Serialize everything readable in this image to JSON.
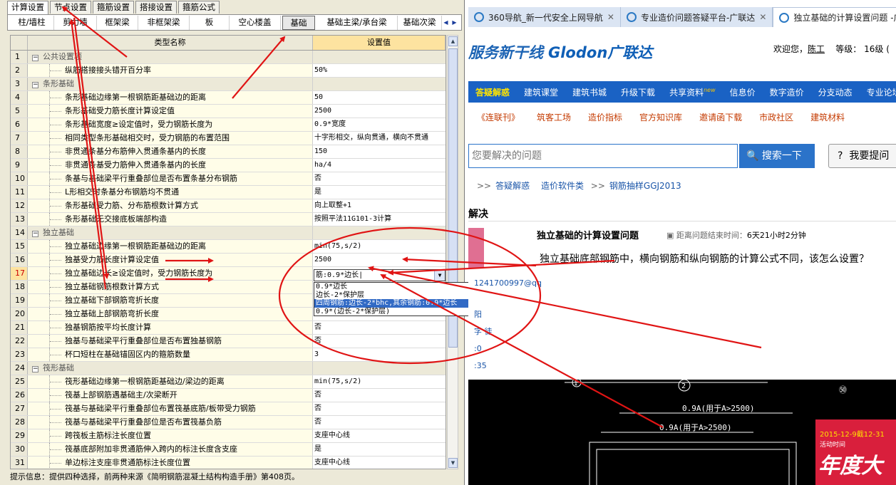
{
  "left_app": {
    "top_tabs": [
      "计算设置",
      "节点设置",
      "箍筋设置",
      "搭接设置",
      "箍筋公式"
    ],
    "sub_tabs": [
      "柱/墙柱",
      "剪力墙",
      "框架梁",
      "非框架梁",
      "板",
      "空心楼盖",
      "基础",
      "基础主梁/承台梁",
      "基础次梁"
    ],
    "grid_header": {
      "name": "类型名称",
      "value": "设置值"
    },
    "rows": [
      {
        "n": "1",
        "name": "公共设置项",
        "value": "",
        "type": "group"
      },
      {
        "n": "2",
        "name": "纵筋搭接接头错开百分率",
        "value": "50%",
        "type": "data"
      },
      {
        "n": "3",
        "name": "条形基础",
        "value": "",
        "type": "group"
      },
      {
        "n": "4",
        "name": "条形基础边缘第一根钢筋距基础边的距离",
        "value": "50",
        "type": "data"
      },
      {
        "n": "5",
        "name": "条形基础受力筋长度计算设定值",
        "value": "2500",
        "type": "data"
      },
      {
        "n": "6",
        "name": "条形基础宽度≥设定值时，受力钢筋长度为",
        "value": "0.9*宽度",
        "type": "data"
      },
      {
        "n": "7",
        "name": "相同类型条形基础相交时，受力钢筋的布置范围",
        "value": "十字形相交，纵向贯通，横向不贯通",
        "type": "data"
      },
      {
        "n": "8",
        "name": "非贯通条基分布筋伸入贯通条基内的长度",
        "value": "150",
        "type": "data"
      },
      {
        "n": "9",
        "name": "非贯通条基受力筋伸入贯通条基内的长度",
        "value": "ha/4",
        "type": "data"
      },
      {
        "n": "10",
        "name": "条基与基础梁平行重叠部位是否布置条基分布钢筋",
        "value": "否",
        "type": "data"
      },
      {
        "n": "11",
        "name": "L形相交时条基分布钢筋均不贯通",
        "value": "是",
        "type": "data"
      },
      {
        "n": "12",
        "name": "条形基础受力筋、分布筋根数计算方式",
        "value": "向上取整+1",
        "type": "data"
      },
      {
        "n": "13",
        "name": "条形基础无交接底板端部构造",
        "value": "按照平法11G101-3计算",
        "type": "data"
      },
      {
        "n": "14",
        "name": "独立基础",
        "value": "",
        "type": "group"
      },
      {
        "n": "15",
        "name": "独立基础边缘第一根钢筋距基础边的距离",
        "value": "min(75,s/2)",
        "type": "data"
      },
      {
        "n": "16",
        "name": "独基受力筋长度计算设定值",
        "value": "2500",
        "type": "data"
      },
      {
        "n": "17",
        "name": "独立基础边长≥设定值时，受力钢筋长度为",
        "value": "",
        "type": "data",
        "selected": true
      },
      {
        "n": "18",
        "name": "独立基础钢筋根数计算方式",
        "value": "",
        "type": "data"
      },
      {
        "n": "19",
        "name": "独立基础下部钢筋弯折长度",
        "value": "",
        "type": "data"
      },
      {
        "n": "20",
        "name": "独立基础上部钢筋弯折长度",
        "value": "",
        "type": "data"
      },
      {
        "n": "21",
        "name": "独基钢筋按平均长度计算",
        "value": "否",
        "type": "data"
      },
      {
        "n": "22",
        "name": "独基与基础梁平行重叠部位是否布置独基钢筋",
        "value": "否",
        "type": "data"
      },
      {
        "n": "23",
        "name": "杯口短柱在基础锚固区内的箍筋数量",
        "value": "3",
        "type": "data"
      },
      {
        "n": "24",
        "name": "筏形基础",
        "value": "",
        "type": "group"
      },
      {
        "n": "25",
        "name": "筏形基础边缘第一根钢筋距基础边/梁边的距离",
        "value": "min(75,s/2)",
        "type": "data"
      },
      {
        "n": "26",
        "name": "筏基上部钢筋遇基础主/次梁断开",
        "value": "否",
        "type": "data"
      },
      {
        "n": "27",
        "name": "筏基与基础梁平行重叠部位布置筏基底筋/板带受力钢筋",
        "value": "否",
        "type": "data"
      },
      {
        "n": "28",
        "name": "筏基与基础梁平行重叠部位是否布置筏基负筋",
        "value": "否",
        "type": "data"
      },
      {
        "n": "29",
        "name": "跨筏板主筋标注长度位置",
        "value": "支座中心线",
        "type": "data"
      },
      {
        "n": "30",
        "name": "筏基底部附加非贯通筋伸入跨内的标注长度含支座",
        "value": "是",
        "type": "data"
      },
      {
        "n": "31",
        "name": "单边标注支座非贯通筋标注长度位置",
        "value": "支座中心线",
        "type": "data"
      }
    ],
    "edit_cell_value": "筋:0.9*边长|",
    "dropdown_options": [
      "0.9*边长",
      "边长-2*保护层",
      "四周钢筋:边长-2*bhc,其余钢筋:0.9*边长",
      "0.9*(边长-2*保护层)"
    ],
    "dropdown_selected_index": 2,
    "status_text": "提示信息：提供四种选择，前两种来源《简明钢筋混凝土结构构造手册》第408页。"
  },
  "browser": {
    "tabs": [
      "360导航_新一代安全上网导航",
      "专业造价问题答疑平台-广联达",
      "独立基础的计算设置问题 -广"
    ],
    "slogan": "服务新干线",
    "logo": "Glodon广联达",
    "welcome": "欢迎您，",
    "username": "陈工",
    "level": "等级： 16级 (",
    "nav1": [
      "答疑解惑",
      "建筑课堂",
      "建筑书城",
      "升级下载",
      "共享资料",
      "信息价",
      "数字造价",
      "分支动态",
      "专业论坛"
    ],
    "nav1_new": "new",
    "nav2": [
      "《连联刊》",
      "筑客工场",
      "造价指标",
      "官方知识库",
      "邀请函下载",
      "市政社区",
      "建筑材料"
    ],
    "search_placeholder": "您要解决的问题",
    "search_button": "搜索一下",
    "ask_button": "我要提问",
    "breadcrumb": [
      "答疑解惑",
      "造价软件类",
      "钢筋抽样GGJ2013"
    ],
    "section_title": "解决",
    "question_title": "独立基础的计算设置问题",
    "question_meta_label": "距离问题结束时间：",
    "question_meta_value": "6天21小时2分钟",
    "question_body": "独立基础底部钢筋中，横向钢筋和纵向钢筋的计算公式不同，该怎么设置？",
    "user_info": [
      "1241700997@qq",
      "阳",
      "字 徒",
      ":0",
      ":35"
    ],
    "drawing_labels": [
      "1",
      "2",
      "0.9A(用于A>2500)",
      "0.9A(用于A>2500)",
      "㊿"
    ],
    "ad": {
      "date": "2015-12-9截12-31",
      "sub": "活动时间",
      "big": "年度大"
    }
  },
  "colors": {
    "arrow": "#e01414",
    "nav_blue": "#1a62c4",
    "highlight": "#316ac5",
    "header_value": "#fde3a0"
  }
}
